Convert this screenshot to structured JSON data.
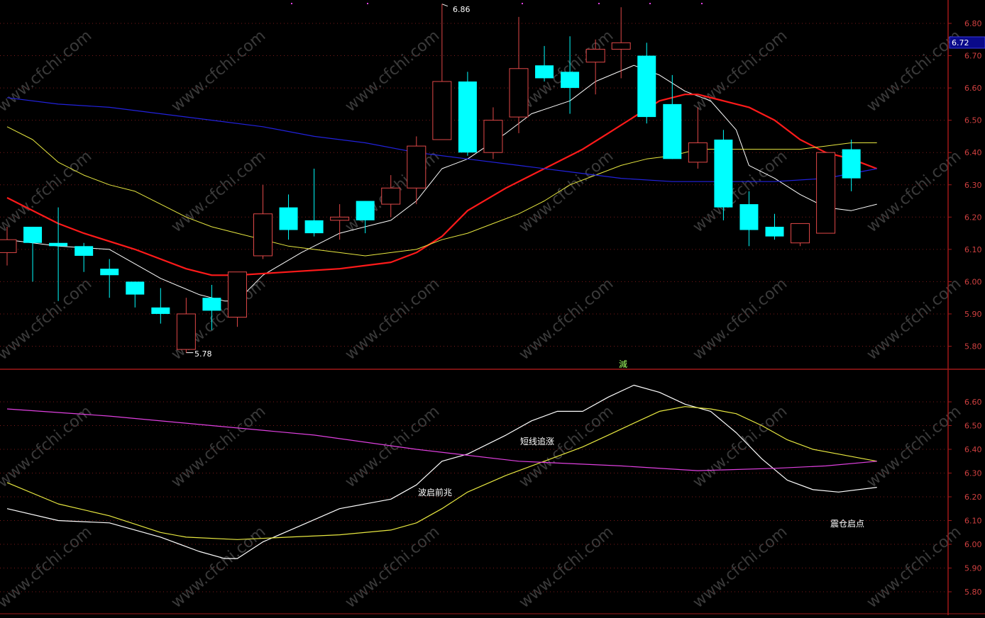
{
  "colors": {
    "background": "#000000",
    "frame": "#a01818",
    "grid": "#7a1a1a",
    "axis_text": "#d04040",
    "up_candle": "#e04848",
    "down_candle": "#00ffff",
    "ma5": "#ffffff",
    "ma10": "#ff1a1a",
    "ma20": "#e8e840",
    "ma60": "#2222dd",
    "sub_white": "#ffffff",
    "sub_yellow": "#e8e840",
    "sub_magenta": "#e040e0",
    "watermark": "#3a3a3a",
    "price_tag_bg": "#0a0a8a",
    "signal_text": "#a0ff60"
  },
  "watermark_text": "www.cfchi.com",
  "price_tag": "6.72",
  "signal_label": "減",
  "main_labels": {
    "high": "6.86",
    "low": "5.78"
  },
  "sub_labels": [
    "波启前兆",
    "短线追涨",
    "震仓启点"
  ],
  "chart_data": [
    {
      "type": "candlestick",
      "ylim": [
        5.72,
        6.88
      ],
      "yticks": [
        "6.80",
        "6.70",
        "6.60",
        "6.50",
        "6.40",
        "6.30",
        "6.20",
        "6.10",
        "6.00",
        "5.90",
        "5.80"
      ],
      "candles": [
        {
          "o": 6.09,
          "h": 6.17,
          "l": 6.05,
          "c": 6.13
        },
        {
          "o": 6.17,
          "h": 6.17,
          "l": 6.0,
          "c": 6.12
        },
        {
          "o": 6.12,
          "h": 6.23,
          "l": 5.94,
          "c": 6.11
        },
        {
          "o": 6.11,
          "h": 6.12,
          "l": 6.03,
          "c": 6.08
        },
        {
          "o": 6.04,
          "h": 6.07,
          "l": 5.95,
          "c": 6.02
        },
        {
          "o": 6.0,
          "h": 6.0,
          "l": 5.92,
          "c": 5.96
        },
        {
          "o": 5.92,
          "h": 5.98,
          "l": 5.87,
          "c": 5.9
        },
        {
          "o": 5.79,
          "h": 5.95,
          "l": 5.78,
          "c": 5.9
        },
        {
          "o": 5.95,
          "h": 5.99,
          "l": 5.85,
          "c": 5.91
        },
        {
          "o": 5.89,
          "h": 6.03,
          "l": 5.86,
          "c": 6.03
        },
        {
          "o": 6.08,
          "h": 6.3,
          "l": 6.07,
          "c": 6.21
        },
        {
          "o": 6.23,
          "h": 6.27,
          "l": 6.13,
          "c": 6.16
        },
        {
          "o": 6.19,
          "h": 6.35,
          "l": 6.14,
          "c": 6.15
        },
        {
          "o": 6.19,
          "h": 6.24,
          "l": 6.13,
          "c": 6.2
        },
        {
          "o": 6.25,
          "h": 6.25,
          "l": 6.15,
          "c": 6.19
        },
        {
          "o": 6.24,
          "h": 6.33,
          "l": 6.2,
          "c": 6.29
        },
        {
          "o": 6.29,
          "h": 6.45,
          "l": 6.24,
          "c": 6.42
        },
        {
          "o": 6.44,
          "h": 6.86,
          "l": 6.44,
          "c": 6.62
        },
        {
          "o": 6.62,
          "h": 6.65,
          "l": 6.39,
          "c": 6.4
        },
        {
          "o": 6.4,
          "h": 6.54,
          "l": 6.38,
          "c": 6.5
        },
        {
          "o": 6.51,
          "h": 6.82,
          "l": 6.46,
          "c": 6.66
        },
        {
          "o": 6.67,
          "h": 6.73,
          "l": 6.62,
          "c": 6.63
        },
        {
          "o": 6.65,
          "h": 6.76,
          "l": 6.52,
          "c": 6.6
        },
        {
          "o": 6.68,
          "h": 6.75,
          "l": 6.58,
          "c": 6.72
        },
        {
          "o": 6.72,
          "h": 6.85,
          "l": 6.63,
          "c": 6.74
        },
        {
          "o": 6.7,
          "h": 6.74,
          "l": 6.49,
          "c": 6.51
        },
        {
          "o": 6.55,
          "h": 6.64,
          "l": 6.38,
          "c": 6.38
        },
        {
          "o": 6.37,
          "h": 6.54,
          "l": 6.35,
          "c": 6.43
        },
        {
          "o": 6.44,
          "h": 6.47,
          "l": 6.19,
          "c": 6.23
        },
        {
          "o": 6.24,
          "h": 6.28,
          "l": 6.11,
          "c": 6.16
        },
        {
          "o": 6.17,
          "h": 6.21,
          "l": 6.13,
          "c": 6.14
        },
        {
          "o": 6.12,
          "h": 6.18,
          "l": 6.11,
          "c": 6.18
        },
        {
          "o": 6.15,
          "h": 6.4,
          "l": 6.15,
          "c": 6.4
        },
        {
          "o": 6.41,
          "h": 6.44,
          "l": 6.28,
          "c": 6.32
        }
      ],
      "series": [
        {
          "key": "ma5",
          "points": [
            [
              0,
              6.13
            ],
            [
              2,
              6.11
            ],
            [
              4,
              6.1
            ],
            [
              6,
              6.01
            ],
            [
              7.5,
              5.96
            ],
            [
              8.5,
              5.94
            ],
            [
              9,
              5.94
            ],
            [
              10,
              6.02
            ],
            [
              11.5,
              6.09
            ],
            [
              13,
              6.15
            ],
            [
              14.5,
              6.18
            ],
            [
              15,
              6.19
            ],
            [
              16,
              6.25
            ],
            [
              17,
              6.35
            ],
            [
              18,
              6.38
            ],
            [
              19.5,
              6.46
            ],
            [
              20.5,
              6.52
            ],
            [
              22,
              6.56
            ],
            [
              23,
              6.62
            ],
            [
              24.5,
              6.67
            ],
            [
              25.5,
              6.64
            ],
            [
              26.5,
              6.59
            ],
            [
              27.5,
              6.56
            ],
            [
              28.5,
              6.47
            ],
            [
              29,
              6.36
            ],
            [
              30,
              6.32
            ],
            [
              31,
              6.27
            ],
            [
              32,
              6.23
            ],
            [
              33,
              6.22
            ],
            [
              34,
              6.24
            ]
          ]
        },
        {
          "key": "ma10",
          "points": [
            [
              0,
              6.26
            ],
            [
              2,
              6.18
            ],
            [
              3,
              6.15
            ],
            [
              5,
              6.1
            ],
            [
              7,
              6.04
            ],
            [
              8,
              6.02
            ],
            [
              9,
              6.02
            ],
            [
              11,
              6.03
            ],
            [
              13,
              6.04
            ],
            [
              15,
              6.06
            ],
            [
              16,
              6.09
            ],
            [
              17,
              6.14
            ],
            [
              18,
              6.22
            ],
            [
              19.5,
              6.29
            ],
            [
              21,
              6.35
            ],
            [
              22.5,
              6.41
            ],
            [
              23.5,
              6.46
            ],
            [
              24.5,
              6.51
            ],
            [
              25.5,
              6.56
            ],
            [
              26.5,
              6.58
            ],
            [
              27,
              6.58
            ],
            [
              28,
              6.56
            ],
            [
              29,
              6.54
            ],
            [
              30,
              6.5
            ],
            [
              31,
              6.44
            ],
            [
              32,
              6.4
            ],
            [
              33,
              6.38
            ],
            [
              34,
              6.35
            ]
          ]
        },
        {
          "key": "ma20",
          "points": [
            [
              0,
              6.48
            ],
            [
              1,
              6.44
            ],
            [
              2,
              6.37
            ],
            [
              3,
              6.33
            ],
            [
              4,
              6.3
            ],
            [
              5,
              6.28
            ],
            [
              6,
              6.24
            ],
            [
              7,
              6.2
            ],
            [
              8,
              6.17
            ],
            [
              9,
              6.15
            ],
            [
              10,
              6.13
            ],
            [
              11,
              6.11
            ],
            [
              12,
              6.1
            ],
            [
              13,
              6.09
            ],
            [
              14,
              6.08
            ],
            [
              15,
              6.09
            ],
            [
              16,
              6.1
            ],
            [
              17,
              6.13
            ],
            [
              18,
              6.15
            ],
            [
              19,
              6.18
            ],
            [
              20,
              6.21
            ],
            [
              21,
              6.25
            ],
            [
              22,
              6.3
            ],
            [
              23,
              6.33
            ],
            [
              24,
              6.36
            ],
            [
              25,
              6.38
            ],
            [
              26,
              6.39
            ],
            [
              27,
              6.41
            ],
            [
              28,
              6.41
            ],
            [
              29,
              6.41
            ],
            [
              30,
              6.41
            ],
            [
              31,
              6.41
            ],
            [
              32,
              6.42
            ],
            [
              33,
              6.43
            ],
            [
              34,
              6.43
            ]
          ]
        },
        {
          "key": "ma60",
          "points": [
            [
              0,
              6.57
            ],
            [
              2,
              6.55
            ],
            [
              4,
              6.54
            ],
            [
              6,
              6.52
            ],
            [
              8,
              6.5
            ],
            [
              10,
              6.48
            ],
            [
              12,
              6.45
            ],
            [
              14,
              6.43
            ],
            [
              16,
              6.4
            ],
            [
              18,
              6.38
            ],
            [
              20,
              6.36
            ],
            [
              22,
              6.34
            ],
            [
              24,
              6.32
            ],
            [
              26,
              6.31
            ],
            [
              28,
              6.31
            ],
            [
              30,
              6.31
            ],
            [
              32,
              6.32
            ],
            [
              34,
              6.35
            ]
          ]
        }
      ],
      "signal_index": 24.5
    },
    {
      "type": "line",
      "ylim": [
        5.73,
        6.74
      ],
      "yticks": [
        "6.60",
        "6.50",
        "6.40",
        "6.30",
        "6.20",
        "6.10",
        "6.00",
        "5.90",
        "5.80"
      ],
      "series": [
        {
          "key": "sub_white",
          "points": [
            [
              0,
              6.15
            ],
            [
              2,
              6.1
            ],
            [
              4,
              6.09
            ],
            [
              6,
              6.03
            ],
            [
              7.5,
              5.97
            ],
            [
              8.5,
              5.94
            ],
            [
              9,
              5.94
            ],
            [
              10,
              6.01
            ],
            [
              11.5,
              6.08
            ],
            [
              13,
              6.15
            ],
            [
              14.5,
              6.18
            ],
            [
              15,
              6.19
            ],
            [
              16,
              6.25
            ],
            [
              17,
              6.35
            ],
            [
              18,
              6.38
            ],
            [
              19.5,
              6.46
            ],
            [
              20.5,
              6.52
            ],
            [
              21.5,
              6.56
            ],
            [
              22.5,
              6.56
            ],
            [
              23.5,
              6.62
            ],
            [
              24.5,
              6.67
            ],
            [
              25.5,
              6.64
            ],
            [
              26.5,
              6.59
            ],
            [
              27.5,
              6.56
            ],
            [
              28.5,
              6.47
            ],
            [
              29.5,
              6.36
            ],
            [
              30.5,
              6.27
            ],
            [
              31.5,
              6.23
            ],
            [
              32.5,
              6.22
            ],
            [
              34,
              6.24
            ]
          ]
        },
        {
          "key": "sub_yellow",
          "points": [
            [
              0,
              6.26
            ],
            [
              2,
              6.17
            ],
            [
              4,
              6.12
            ],
            [
              6,
              6.05
            ],
            [
              7,
              6.03
            ],
            [
              9,
              6.02
            ],
            [
              11,
              6.03
            ],
            [
              13,
              6.04
            ],
            [
              15,
              6.06
            ],
            [
              16,
              6.09
            ],
            [
              17,
              6.15
            ],
            [
              18,
              6.22
            ],
            [
              19.5,
              6.29
            ],
            [
              21,
              6.35
            ],
            [
              22.5,
              6.41
            ],
            [
              23.5,
              6.46
            ],
            [
              24.5,
              6.51
            ],
            [
              25.5,
              6.56
            ],
            [
              26.5,
              6.58
            ],
            [
              27.5,
              6.57
            ],
            [
              28.5,
              6.55
            ],
            [
              29.5,
              6.5
            ],
            [
              30.5,
              6.44
            ],
            [
              31.5,
              6.4
            ],
            [
              32.5,
              6.38
            ],
            [
              34,
              6.35
            ]
          ]
        },
        {
          "key": "sub_magenta",
          "points": [
            [
              0,
              6.57
            ],
            [
              4,
              6.54
            ],
            [
              8,
              6.5
            ],
            [
              12,
              6.46
            ],
            [
              16,
              6.4
            ],
            [
              20,
              6.35
            ],
            [
              24,
              6.33
            ],
            [
              27,
              6.31
            ],
            [
              30,
              6.32
            ],
            [
              32,
              6.33
            ],
            [
              34,
              6.35
            ]
          ]
        }
      ]
    }
  ]
}
